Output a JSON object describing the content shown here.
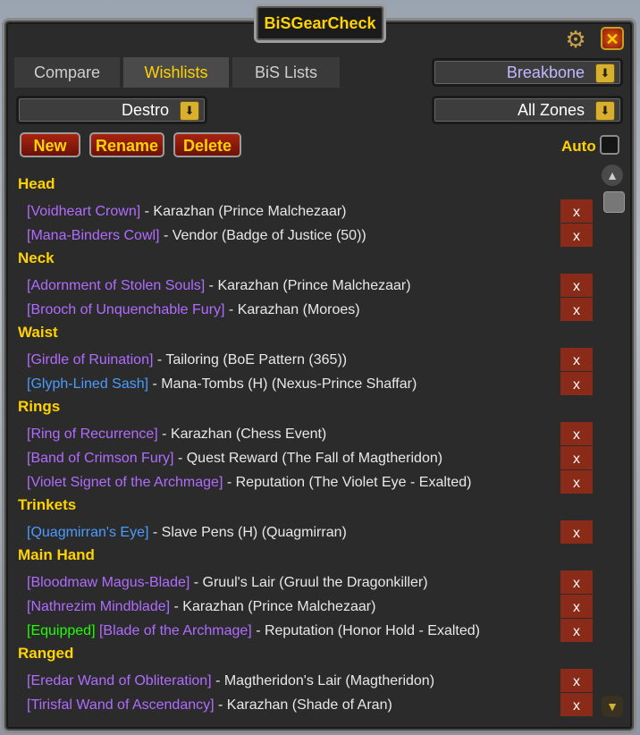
{
  "window": {
    "title": "BiSGearCheck"
  },
  "tabs": [
    {
      "label": "Compare"
    },
    {
      "label": "Wishlists"
    },
    {
      "label": "BiS Lists"
    }
  ],
  "active_tab": "Wishlists",
  "dropdowns": {
    "character": "Breakbone",
    "spec": "Destro",
    "zone": "All Zones"
  },
  "buttons": {
    "new": "New",
    "rename": "Rename",
    "delete": "Delete"
  },
  "auto": {
    "label": "Auto",
    "checked": false
  },
  "remove_label": "x",
  "categories": [
    {
      "name": "Head",
      "items": [
        {
          "item": "[Voidheart Crown]",
          "quality": "epic",
          "source": " - Karazhan (Prince Malchezaar)"
        },
        {
          "item": "[Mana-Binders Cowl]",
          "quality": "epic",
          "source": " - Vendor (Badge of Justice (50))"
        }
      ]
    },
    {
      "name": "Neck",
      "items": [
        {
          "item": "[Adornment of Stolen Souls]",
          "quality": "epic",
          "source": " - Karazhan (Prince Malchezaar)"
        },
        {
          "item": "[Brooch of Unquenchable Fury]",
          "quality": "epic",
          "source": " - Karazhan (Moroes)"
        }
      ]
    },
    {
      "name": "Waist",
      "items": [
        {
          "item": "[Girdle of Ruination]",
          "quality": "epic",
          "source": " - Tailoring (BoE Pattern (365))"
        },
        {
          "item": "[Glyph-Lined Sash]",
          "quality": "rare",
          "source": " - Mana-Tombs (H) (Nexus-Prince Shaffar)"
        }
      ]
    },
    {
      "name": "Rings",
      "items": [
        {
          "item": "[Ring of Recurrence]",
          "quality": "epic",
          "source": " - Karazhan (Chess Event)"
        },
        {
          "item": "[Band of Crimson Fury]",
          "quality": "epic",
          "source": " - Quest Reward (The Fall of Magtheridon)"
        },
        {
          "item": "[Violet Signet of the Archmage]",
          "quality": "epic",
          "source": " - Reputation (The Violet Eye - Exalted)"
        }
      ]
    },
    {
      "name": "Trinkets",
      "items": [
        {
          "item": "[Quagmirran's Eye]",
          "quality": "rare",
          "source": " - Slave Pens (H) (Quagmirran)"
        }
      ]
    },
    {
      "name": "Main Hand",
      "items": [
        {
          "item": "[Bloodmaw Magus-Blade]",
          "quality": "epic",
          "source": " - Gruul's Lair (Gruul the Dragonkiller)"
        },
        {
          "item": "[Nathrezim Mindblade]",
          "quality": "epic",
          "source": " - Karazhan (Prince Malchezaar)"
        },
        {
          "equipped": "[Equipped]",
          "item": "[Blade of the Archmage]",
          "quality": "epic",
          "source": " - Reputation (Honor Hold - Exalted)"
        }
      ]
    },
    {
      "name": "Ranged",
      "items": [
        {
          "item": "[Eredar Wand of Obliteration]",
          "quality": "epic",
          "source": " - Magtheridon's Lair (Magtheridon)"
        },
        {
          "item": "[Tirisfal Wand of Ascendancy]",
          "quality": "epic",
          "source": " - Karazhan (Shade of Aran)"
        }
      ]
    }
  ],
  "colors": {
    "gold": "#ffd200",
    "epic": "#b06cff",
    "rare": "#4a9cff",
    "equipped": "#1eff00",
    "remove_bg": "#8a2a18"
  }
}
